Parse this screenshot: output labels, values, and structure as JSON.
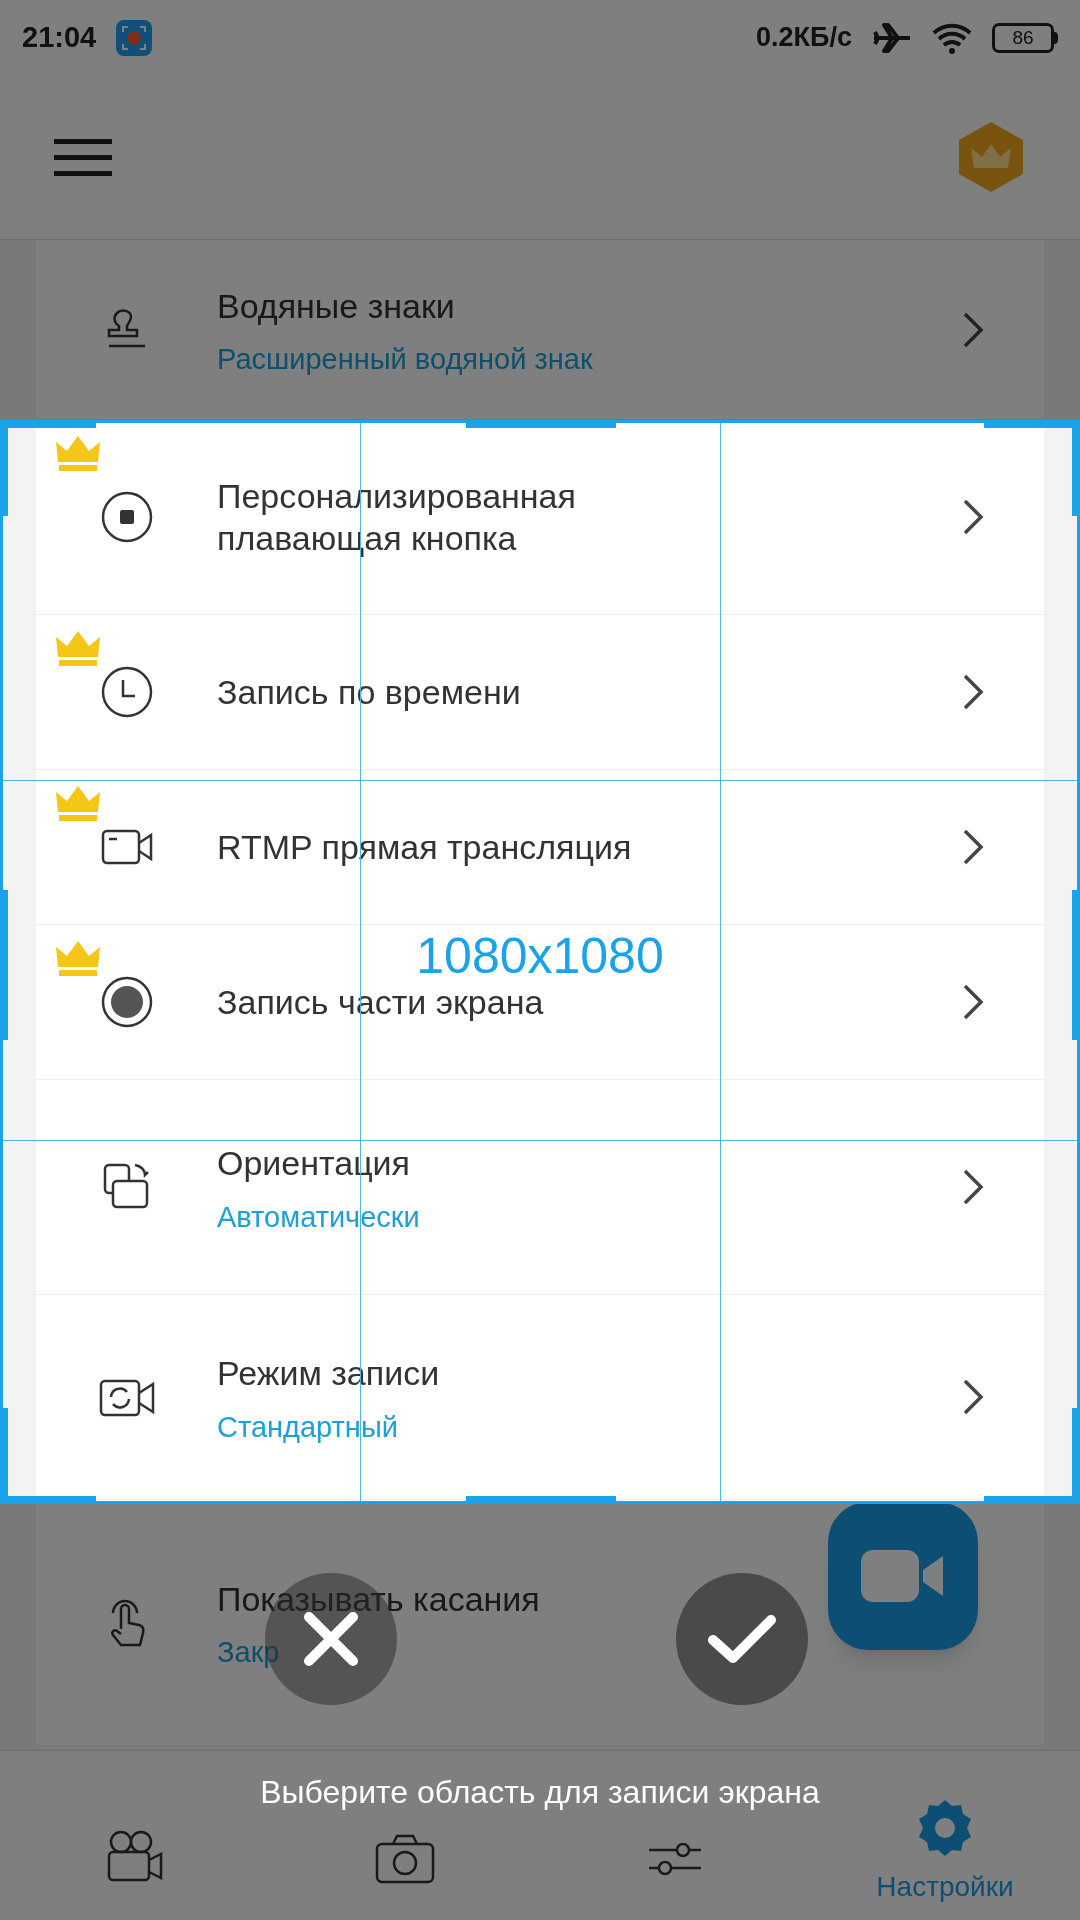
{
  "status_bar": {
    "time": "21:04",
    "network_speed": "0.2КБ/с",
    "battery": "86"
  },
  "settings": [
    {
      "title": "Водяные знаки",
      "subtitle": "Расширенный водяной знак",
      "premium": false
    },
    {
      "title": "Персонализированная плавающая кнопка",
      "premium": true
    },
    {
      "title": "Запись по времени",
      "premium": true
    },
    {
      "title": "RTMP прямая трансляция",
      "premium": true
    },
    {
      "title": "Запись части экрана",
      "premium": true
    },
    {
      "title": "Ориентация",
      "subtitle": "Автоматически",
      "premium": false
    },
    {
      "title": "Режим записи",
      "subtitle": "Стандартный",
      "premium": false
    },
    {
      "title": "Показывать касания",
      "subtitle": "Закр",
      "premium": false
    }
  ],
  "nav": [
    {
      "selected": false
    },
    {
      "selected": false
    },
    {
      "selected": false
    },
    {
      "label": "Настройки",
      "selected": true
    }
  ],
  "selection": {
    "size_label": "1080x1080"
  },
  "hint": "Выберите область для записи экрана"
}
